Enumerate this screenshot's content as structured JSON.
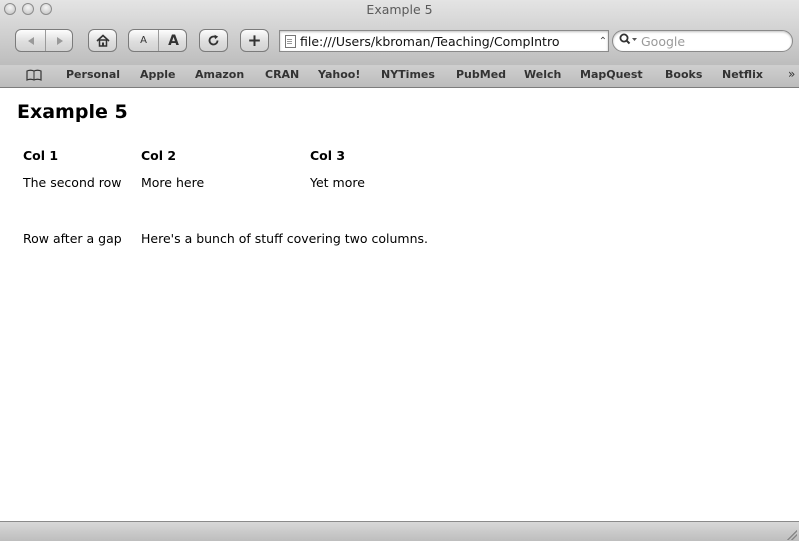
{
  "window": {
    "title": "Example 5"
  },
  "toolbar": {
    "back_icon": "back-arrow-icon",
    "forward_icon": "forward-arrow-icon",
    "home_icon": "home-icon",
    "text_smaller_label": "A",
    "text_bigger_label": "A",
    "reload_icon": "reload-icon",
    "add_bookmark_label": "+",
    "url": "file:///Users/kbroman/Teaching/CompIntro",
    "search_placeholder": "Google"
  },
  "bookmarks": {
    "icon": "open-book-icon",
    "items": [
      {
        "label": "Personal"
      },
      {
        "label": "Apple"
      },
      {
        "label": "Amazon"
      },
      {
        "label": "CRAN"
      },
      {
        "label": "Yahoo!"
      },
      {
        "label": "NYTimes"
      },
      {
        "label": "PubMed"
      },
      {
        "label": "Welch"
      },
      {
        "label": "MapQuest"
      },
      {
        "label": "Books"
      },
      {
        "label": "Netflix"
      }
    ],
    "overflow_label": "»"
  },
  "page": {
    "heading": "Example 5",
    "table": {
      "headers": [
        "Col 1",
        "Col 2",
        "Col 3"
      ],
      "row2": [
        "The second row",
        "More here",
        "Yet more"
      ],
      "row4": [
        "Row after a gap",
        "Here's a bunch of stuff covering two columns."
      ]
    }
  }
}
